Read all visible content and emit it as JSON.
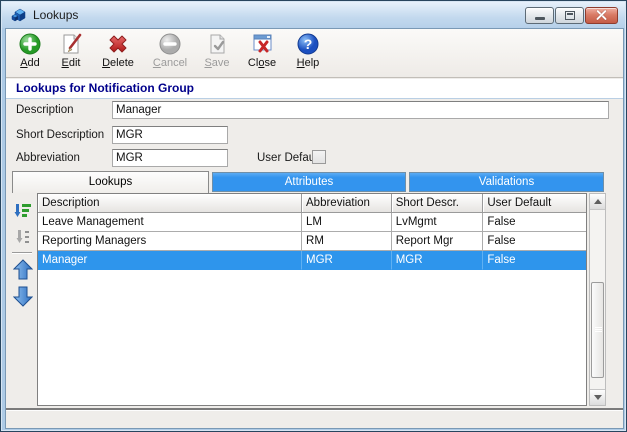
{
  "window": {
    "title": "Lookups",
    "app_icon": "blue-cube-icon",
    "controls": [
      {
        "name": "minimize-button"
      },
      {
        "name": "maximize-button"
      },
      {
        "name": "close-button"
      }
    ]
  },
  "toolbar": {
    "buttons": [
      {
        "icon": "add-icon",
        "pre": "",
        "u": "A",
        "post": "dd",
        "enabled": true
      },
      {
        "icon": "edit-icon",
        "pre": "",
        "u": "E",
        "post": "dit",
        "enabled": true
      },
      {
        "icon": "delete-icon",
        "pre": "",
        "u": "D",
        "post": "elete",
        "enabled": true
      },
      {
        "icon": "cancel-icon",
        "pre": "",
        "u": "C",
        "post": "ancel",
        "enabled": false
      },
      {
        "icon": "save-icon",
        "pre": "",
        "u": "S",
        "post": "ave",
        "enabled": false
      },
      {
        "icon": "close-window-icon",
        "pre": "Cl",
        "u": "o",
        "post": "se",
        "enabled": true
      },
      {
        "icon": "help-icon",
        "pre": "",
        "u": "H",
        "post": "elp",
        "enabled": true
      }
    ]
  },
  "header": {
    "title": "Lookups for Notification Group"
  },
  "form": {
    "fields": [
      {
        "label": "Description",
        "value": "Manager"
      },
      {
        "label": "Short Description",
        "value": "MGR"
      },
      {
        "label": "Abbreviation",
        "value": "MGR"
      }
    ],
    "user_default": {
      "label": "User Default",
      "checked": false
    }
  },
  "tabs": [
    {
      "label": "Lookups",
      "active": true
    },
    {
      "label": "Attributes",
      "active": false
    },
    {
      "label": "Validations",
      "active": false
    }
  ],
  "side_buttons": [
    {
      "icon": "sort-list-icon"
    },
    {
      "icon": "sort-numeric-icon"
    },
    {
      "icon": "move-up-icon"
    },
    {
      "icon": "move-down-icon"
    }
  ],
  "table": {
    "columns": [
      "Description",
      "Abbreviation",
      "Short Descr.",
      "User Default"
    ],
    "rows": [
      {
        "selected": false,
        "cells": [
          "Leave Management",
          "LM",
          "LvMgmt",
          "False"
        ]
      },
      {
        "selected": false,
        "cells": [
          "Reporting Managers",
          "RM",
          "Report Mgr",
          "False"
        ]
      },
      {
        "selected": true,
        "cells": [
          "Manager",
          "MGR",
          "MGR",
          "False"
        ]
      }
    ]
  },
  "glyphs": {
    "help": "?"
  },
  "colors": {
    "tab_inactive": "#3394ee",
    "selection": "#2e95ec",
    "header_text": "#00008b",
    "frame": "#aecbe6"
  }
}
